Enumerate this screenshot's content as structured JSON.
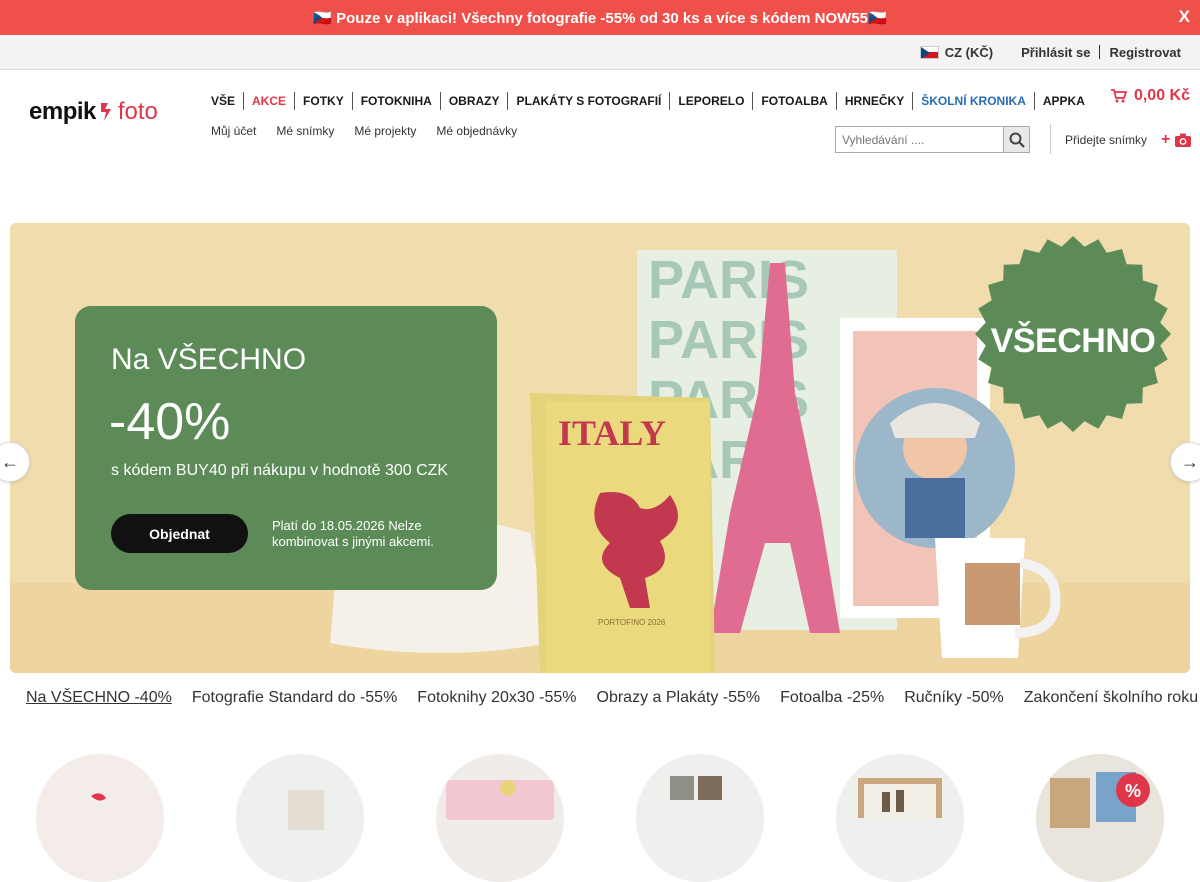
{
  "promo_bar": {
    "text": "🇨🇿 Pouze v aplikaci! Všechny fotografie -55% od 30 ks a více s kódem NOW55🇨🇿",
    "close_label": "X"
  },
  "util_bar": {
    "language": "CZ (KČ)",
    "login": "Přihlásit se",
    "register": "Registrovat"
  },
  "logo": {
    "brand": "empik",
    "suffix": "foto"
  },
  "main_nav": [
    {
      "label": "VŠE"
    },
    {
      "label": "AKCE"
    },
    {
      "label": "FOTKY"
    },
    {
      "label": "FOTOKNIHA"
    },
    {
      "label": "OBRAZY"
    },
    {
      "label": "PLAKÁTY S FOTOGRAFIÍ"
    },
    {
      "label": "LEPORELO"
    },
    {
      "label": "FOTOALBA"
    },
    {
      "label": "HRNEČKY"
    },
    {
      "label": "ŠKOLNÍ KRONIKA"
    },
    {
      "label": "APPKA"
    }
  ],
  "sub_nav": [
    {
      "label": "Můj účet"
    },
    {
      "label": "Mé snímky"
    },
    {
      "label": "Mé projekty"
    },
    {
      "label": "Mé objednávky"
    }
  ],
  "cart": {
    "total": "0,00 Kč",
    "icon": "cart-icon"
  },
  "search": {
    "placeholder": "Vyhledávání ....",
    "value": ""
  },
  "add_photos": {
    "label": "Přidejte snímky"
  },
  "hero": {
    "heading": "Na VŠECHNO",
    "discount": "-40%",
    "code_text": "s kódem BUY40 při nákupu v hodnotě 300 CZK",
    "button": "Objednat",
    "valid_text": "Platí do 18.05.2026 Nelze kombinovat s jinými akcemi.",
    "badge": "VŠECHNO",
    "book_title": "ITALY",
    "book_sub": "PORTOFINO 2026",
    "poster_word": "PARIS",
    "colors": {
      "card": "#5c8b57",
      "badge": "#5c8b57",
      "background": "#f1dcae"
    }
  },
  "tabs": [
    {
      "label": "Na VŠECHNO -40%",
      "active": true
    },
    {
      "label": "Fotografie Standard do -55%"
    },
    {
      "label": "Fotoknihy 20x30 -55%"
    },
    {
      "label": "Obrazy a Plakáty -55%"
    },
    {
      "label": "Fotoalba -25%"
    },
    {
      "label": "Ručníky -50%"
    },
    {
      "label": "Zakončení školního roku"
    }
  ],
  "category_badge": "%"
}
